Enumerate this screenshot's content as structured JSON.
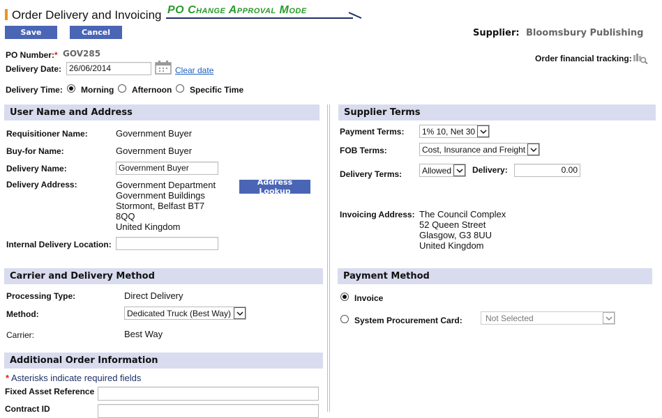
{
  "header": {
    "title": "Order Delivery and Invoicing",
    "mode_banner": "PO Change Approval Mode",
    "save_label": "Save",
    "cancel_label": "Cancel",
    "supplier_label": "Supplier:",
    "supplier_name": "Bloomsbury Publishing",
    "financial_tracking_label": "Order financial tracking:"
  },
  "po": {
    "number_label": "PO Number:",
    "required_marker": "*",
    "number": "GOV285",
    "delivery_date_label": "Delivery Date:",
    "delivery_date": "26/06/2014",
    "clear_date_label": "Clear date",
    "delivery_time_label": "Delivery Time:",
    "delivery_time_options": [
      "Morning",
      "Afternoon",
      "Specific Time"
    ],
    "delivery_time_selected": "Morning"
  },
  "user_section": {
    "title": "User Name and Address",
    "requisitioner_label": "Requisitioner Name:",
    "requisitioner": "Government Buyer",
    "buy_for_label": "Buy-for Name:",
    "buy_for": "Government Buyer",
    "delivery_name_label": "Delivery Name:",
    "delivery_name": "Government Buyer",
    "delivery_address_label": "Delivery Address:",
    "delivery_address": [
      "Government Department",
      "Government Buildings",
      "Stormont, Belfast BT7",
      "8QQ",
      "United Kingdom"
    ],
    "address_lookup_label": "Address Lookup",
    "internal_location_label": "Internal Delivery Location:",
    "internal_location": ""
  },
  "supplier_terms": {
    "title": "Supplier Terms",
    "payment_terms_label": "Payment Terms:",
    "payment_terms": "1% 10, Net 30",
    "fob_terms_label": "FOB Terms:",
    "fob_terms": "Cost, Insurance and Freight",
    "delivery_terms_label": "Delivery Terms:",
    "delivery_terms": "Allowed",
    "delivery_label": "Delivery:",
    "delivery_amount": "0.00",
    "invoicing_address_label": "Invoicing Address:",
    "invoicing_address": [
      "The Council Complex",
      "52 Queen Street",
      "Glasgow, G3 8UU",
      "United Kingdom"
    ]
  },
  "carrier_section": {
    "title": "Carrier and Delivery Method",
    "processing_type_label": "Processing Type:",
    "processing_type": "Direct Delivery",
    "method_label": "Method:",
    "method": "Dedicated Truck (Best Way)",
    "carrier_label": "Carrier:",
    "carrier": "Best Way"
  },
  "payment_method": {
    "title": "Payment Method",
    "invoice_label": "Invoice",
    "procurement_card_label": "System Procurement Card:",
    "procurement_card_value": "Not Selected",
    "selected": "Invoice"
  },
  "additional_info": {
    "title": "Additional Order Information",
    "required_note": "Asterisks indicate required fields",
    "required_marker": "*",
    "fixed_asset_label": "Fixed Asset Reference",
    "fixed_asset": "",
    "contract_id_label": "Contract ID",
    "contract_id": ""
  },
  "colors": {
    "button_bg": "#4a65b5",
    "section_header_bg": "#d9dcef",
    "mode_banner": "#2a9a2a",
    "title_accent": "#e8961e",
    "required": "#e02020",
    "link": "#1a5fbf"
  }
}
